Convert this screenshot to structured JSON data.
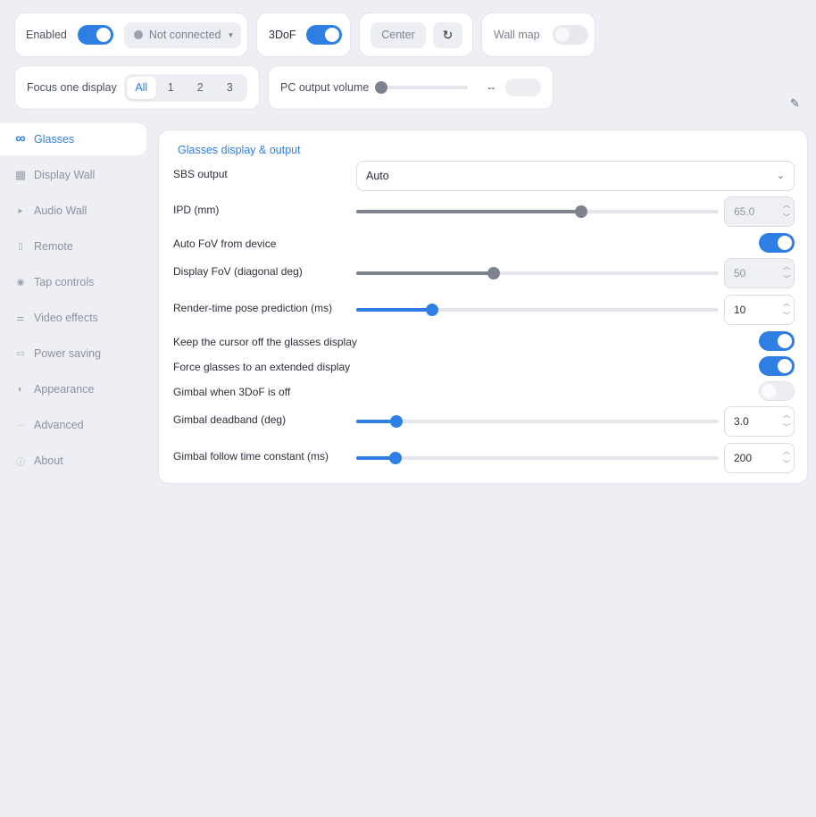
{
  "topbar": {
    "enabled_label": "Enabled",
    "enabled_on": true,
    "connection_status": "Not connected",
    "dof_label": "3DoF",
    "dof_on": true,
    "center_label": "Center",
    "wall_map_label": "Wall map",
    "wall_map_on": false,
    "focus_label": "Focus one display",
    "focus_options": [
      "All",
      "1",
      "2",
      "3"
    ],
    "focus_selected": "All",
    "volume_label": "PC output volume",
    "volume_value": "--",
    "volume_level": 0
  },
  "sidebar": {
    "items": [
      {
        "label": "Glasses",
        "icon": "glasses-icon",
        "glyph": "∞",
        "active": true
      },
      {
        "label": "Display Wall",
        "icon": "grid-icon",
        "glyph": "▦",
        "active": false
      },
      {
        "label": "Audio Wall",
        "icon": "play-icon",
        "glyph": "▸",
        "active": false
      },
      {
        "label": "Remote",
        "icon": "phone-icon",
        "glyph": "▯",
        "active": false
      },
      {
        "label": "Tap controls",
        "icon": "target-icon",
        "glyph": "◉",
        "active": false
      },
      {
        "label": "Video effects",
        "icon": "sliders-icon",
        "glyph": "⚌",
        "active": false
      },
      {
        "label": "Power saving",
        "icon": "battery-icon",
        "glyph": "▭",
        "active": false
      },
      {
        "label": "Appearance",
        "icon": "contrast-icon",
        "glyph": "◐",
        "active": false
      },
      {
        "label": "Advanced",
        "icon": "more-icon",
        "glyph": "···",
        "active": false
      },
      {
        "label": "About",
        "icon": "info-icon",
        "glyph": "ⓘ",
        "active": false
      }
    ]
  },
  "panel": {
    "title": "Glasses display & output",
    "sbs_label": "SBS output",
    "sbs_value": "Auto",
    "ipd_label": "IPD (mm)",
    "ipd_value": "65.0",
    "ipd_fraction": 0.62,
    "auto_fov_label": "Auto FoV from device",
    "auto_fov_on": true,
    "fov_label": "Display FoV (diagonal deg)",
    "fov_value": "50",
    "fov_fraction": 0.38,
    "pose_label": "Render-time pose prediction (ms)",
    "pose_value": "10",
    "pose_fraction": 0.21,
    "cursor_label": "Keep the cursor off the glasses display",
    "cursor_on": true,
    "extended_label": "Force glasses to an extended display",
    "extended_on": true,
    "gimbal_label": "Gimbal when 3DoF is off",
    "gimbal_on": false,
    "deadband_label": "Gimbal deadband (deg)",
    "deadband_value": "3.0",
    "deadband_fraction": 0.11,
    "follow_label": "Gimbal follow time constant (ms)",
    "follow_value": "200",
    "follow_fraction": 0.108
  },
  "colors": {
    "accent": "#2f7ee4",
    "background": "#eeeff4",
    "slider_disabled": "#7d828f"
  }
}
